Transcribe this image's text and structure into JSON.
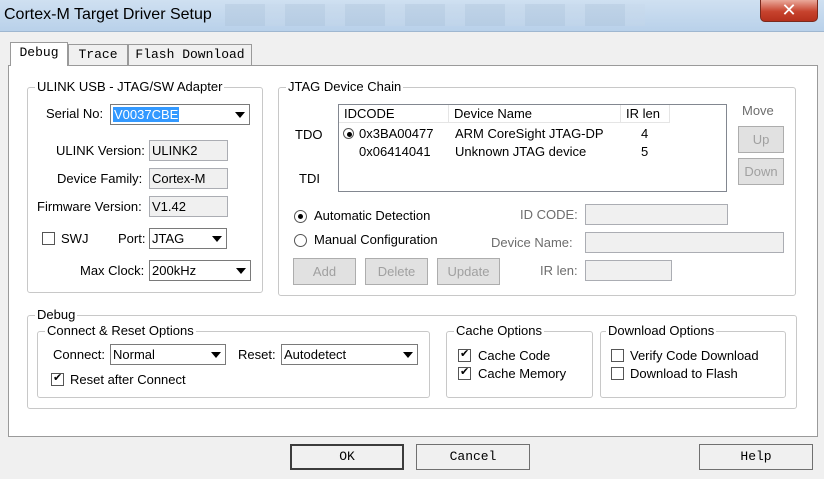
{
  "window": {
    "title": "Cortex-M Target Driver Setup"
  },
  "tabs": [
    {
      "label": "Debug"
    },
    {
      "label": "Trace"
    },
    {
      "label": "Flash Download"
    }
  ],
  "ulink": {
    "legend": "ULINK USB - JTAG/SW Adapter",
    "serial_label": "Serial No:",
    "serial_value": "V0037CBE",
    "version_label": "ULINK Version:",
    "version_value": "ULINK2",
    "family_label": "Device Family:",
    "family_value": "Cortex-M",
    "firmware_label": "Firmware Version:",
    "firmware_value": "V1.42",
    "swj_label": "SWJ",
    "swj_checked": false,
    "port_label": "Port:",
    "port_value": "JTAG",
    "clock_label": "Max Clock:",
    "clock_value": "200kHz"
  },
  "jtag": {
    "legend": "JTAG Device Chain",
    "tdo_label": "TDO",
    "tdi_label": "TDI",
    "columns": [
      "IDCODE",
      "Device Name",
      "IR len"
    ],
    "rows": [
      {
        "idcode": "0x3BA00477",
        "name": "ARM CoreSight JTAG-DP",
        "irlen": "4",
        "selected": true
      },
      {
        "idcode": "0x06414041",
        "name": "Unknown JTAG device",
        "irlen": "5",
        "selected": false
      }
    ],
    "move_label": "Move",
    "up_label": "Up",
    "down_label": "Down",
    "auto_label": "Automatic Detection",
    "manual_label": "Manual Configuration",
    "idcode_label": "ID CODE:",
    "devname_label": "Device Name:",
    "irlen_label": "IR len:",
    "add_label": "Add",
    "delete_label": "Delete",
    "update_label": "Update"
  },
  "debug": {
    "legend": "Debug",
    "connect_legend": "Connect & Reset Options",
    "connect_label": "Connect:",
    "connect_value": "Normal",
    "reset_label": "Reset:",
    "reset_value": "Autodetect",
    "reset_after_label": "Reset after Connect",
    "reset_after_checked": true,
    "cache_legend": "Cache Options",
    "cache_code_label": "Cache Code",
    "cache_code_checked": true,
    "cache_memory_label": "Cache Memory",
    "cache_memory_checked": true,
    "download_legend": "Download Options",
    "verify_label": "Verify Code Download",
    "verify_checked": false,
    "flash_label": "Download to Flash",
    "flash_checked": false
  },
  "footer": {
    "ok_label": "OK",
    "cancel_label": "Cancel",
    "help_label": "Help"
  },
  "colors": {
    "selection": "#3399ff",
    "close_button": "#c7432e"
  }
}
